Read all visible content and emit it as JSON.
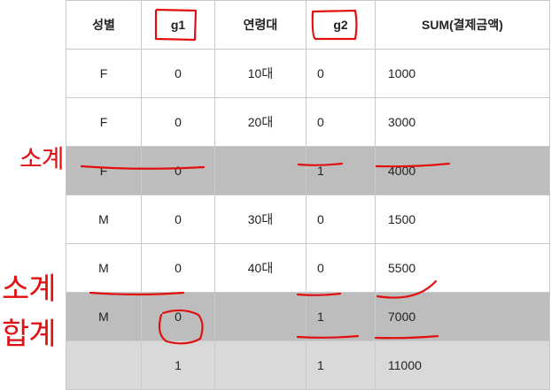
{
  "table": {
    "headers": [
      "성별",
      "g1",
      "연령대",
      "g2",
      "SUM(결제금액)"
    ],
    "rows": [
      {
        "gender": "F",
        "g1": "0",
        "age": "10대",
        "g2": "0",
        "sum": "1000"
      },
      {
        "gender": "F",
        "g1": "0",
        "age": "20대",
        "g2": "0",
        "sum": "3000"
      },
      {
        "gender": "F",
        "g1": "0",
        "age": "",
        "g2": "1",
        "sum": "4000"
      },
      {
        "gender": "M",
        "g1": "0",
        "age": "30대",
        "g2": "0",
        "sum": "1500"
      },
      {
        "gender": "M",
        "g1": "0",
        "age": "40대",
        "g2": "0",
        "sum": "5500"
      },
      {
        "gender": "M",
        "g1": "0",
        "age": "",
        "g2": "1",
        "sum": "7000"
      },
      {
        "gender": "",
        "g1": "1",
        "age": "",
        "g2": "1",
        "sum": "11000"
      }
    ]
  },
  "annotations": {
    "subtotal_1": "소계",
    "subtotal_2": "소계",
    "grand_total": "합계"
  },
  "colors": {
    "ink": "#e01010",
    "subtotal_fill": "#bdbdbd",
    "total_fill": "#d9d9d9",
    "border": "#c9c9c9"
  }
}
